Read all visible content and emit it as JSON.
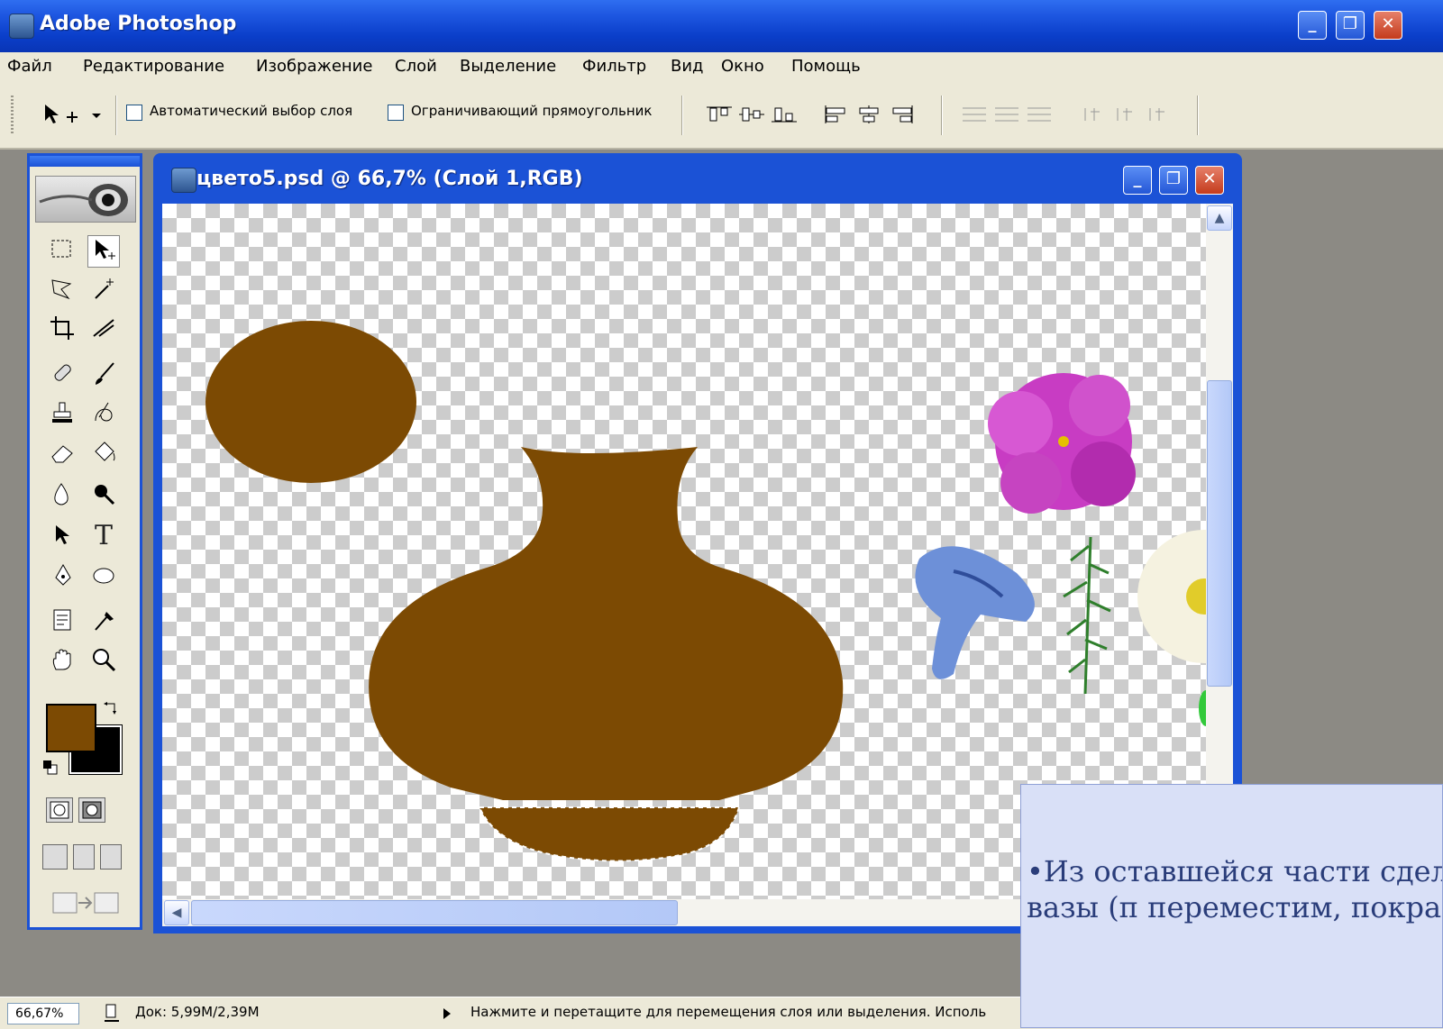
{
  "window": {
    "app_title": "Adobe Photoshop",
    "minimize": "_",
    "restore": "❐",
    "close": "✕"
  },
  "menu": [
    "Файл",
    "Редактирование",
    "Изображение",
    "Слой",
    "Выделение",
    "Фильтр",
    "Вид",
    "Окно",
    "Помощь"
  ],
  "options": {
    "auto_select_label": "Автоматический выбор слоя",
    "bounding_box_label": "Ограничивающий прямоугольник"
  },
  "toolbox": {
    "tools": [
      "marquee-icon",
      "move-icon",
      "lasso-icon",
      "magic-wand-icon",
      "crop-icon",
      "slice-icon",
      "healing-brush-icon",
      "brush-icon",
      "clone-stamp-icon",
      "history-brush-icon",
      "eraser-icon",
      "paint-bucket-icon",
      "blur-icon",
      "dodge-icon",
      "path-select-icon",
      "type-icon",
      "pen-icon",
      "ellipse-shape-icon",
      "notes-icon",
      "eyedropper-icon",
      "hand-icon",
      "zoom-icon"
    ],
    "type_glyph": "T",
    "foreground_color": "#7c4a03",
    "background_color": "#000000"
  },
  "document": {
    "title": "цвето5.psd @ 66,7% (Слой 1,RGB)",
    "fill_color": "#7c4a03"
  },
  "status": {
    "zoom": "66,67%",
    "doc_size": "Док: 5,99M/2,39M",
    "hint": "Нажмите и перетащите для перемещения слоя или выделения. Исполь"
  },
  "caption": {
    "text": "•Из оставшейся части сделаем низ вазы (п переместим, покрас"
  }
}
